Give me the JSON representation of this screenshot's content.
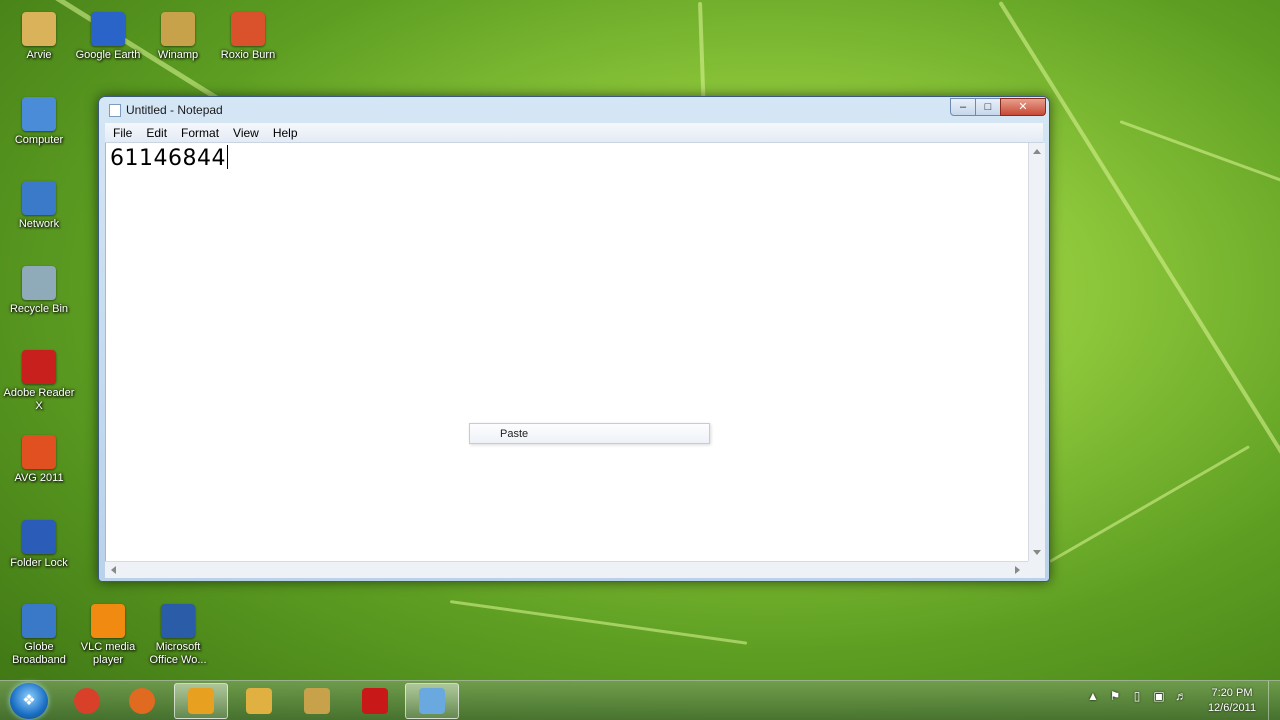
{
  "desktop": {
    "icons": [
      {
        "label": "Arvie",
        "icon": "folder-icon",
        "color": "#d9b25a"
      },
      {
        "label": "Google Earth",
        "icon": "google-earth-icon",
        "color": "#2b64c8"
      },
      {
        "label": "Winamp",
        "icon": "winamp-icon",
        "color": "#c8a24a"
      },
      {
        "label": "Roxio Burn",
        "icon": "roxio-burn-icon",
        "color": "#d9522b"
      },
      {
        "label": "Computer",
        "icon": "computer-icon",
        "color": "#4a8cd8"
      },
      {
        "label": "Network",
        "icon": "network-icon",
        "color": "#3a7ac8"
      },
      {
        "label": "Recycle Bin",
        "icon": "recycle-bin-icon",
        "color": "#8faab8"
      },
      {
        "label": "Adobe Reader X",
        "icon": "adobe-reader-icon",
        "color": "#c8201c"
      },
      {
        "label": "AVG 2011",
        "icon": "avg-icon",
        "color": "#e05020"
      },
      {
        "label": "Folder Lock",
        "icon": "folder-lock-icon",
        "color": "#2a5cb8"
      },
      {
        "label": "Globe Broadband",
        "icon": "globe-broadband-icon",
        "color": "#3a78c8"
      },
      {
        "label": "VLC media player",
        "icon": "vlc-icon",
        "color": "#f08a10"
      },
      {
        "label": "Microsoft Office Wo...",
        "icon": "word-icon",
        "color": "#2a5ca8"
      }
    ]
  },
  "notepad": {
    "title": "Untitled - Notepad",
    "menu": [
      "File",
      "Edit",
      "Format",
      "View",
      "Help"
    ],
    "text": "61146844",
    "context_menu": {
      "item": "Paste"
    }
  },
  "taskbar": {
    "pinned": [
      {
        "name": "chrome-icon",
        "color": "#d8402a"
      },
      {
        "name": "firefox-icon",
        "color": "#e06a20"
      },
      {
        "name": "windows-media-icon",
        "color": "#e8a020"
      },
      {
        "name": "explorer-icon",
        "color": "#e0b040"
      },
      {
        "name": "winamp-icon",
        "color": "#c8a24a"
      },
      {
        "name": "record-icon",
        "color": "#c81818"
      },
      {
        "name": "notepad-icon",
        "color": "#6aa8e0"
      }
    ],
    "clock": {
      "time": "7:20 PM",
      "date": "12/6/2011"
    }
  }
}
